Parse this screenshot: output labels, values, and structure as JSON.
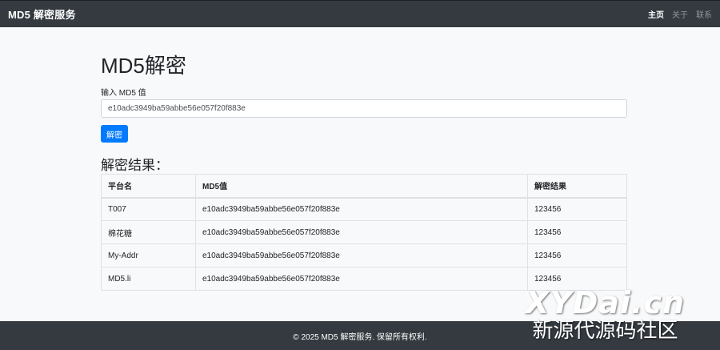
{
  "navbar": {
    "brand": "MD5 解密服务",
    "links": [
      {
        "label": "主页",
        "active": true
      },
      {
        "label": "关于",
        "active": false
      },
      {
        "label": "联系",
        "active": false
      }
    ]
  },
  "form": {
    "title": "MD5解密",
    "label": "输入 MD5 值",
    "input_value": "e10adc3949ba59abbe56e057f20f883e",
    "button_label": "解密"
  },
  "results": {
    "title": "解密结果：",
    "columns": [
      "平台名",
      "MD5值",
      "解密结果"
    ],
    "rows": [
      [
        "T007",
        "e10adc3949ba59abbe56e057f20f883e",
        "123456"
      ],
      [
        "棉花糖",
        "e10adc3949ba59abbe56e057f20f883e",
        "123456"
      ],
      [
        "My-Addr",
        "e10adc3949ba59abbe56e057f20f883e",
        "123456"
      ],
      [
        "MD5.li",
        "e10adc3949ba59abbe56e057f20f883e",
        "123456"
      ]
    ]
  },
  "footer": {
    "text": "© 2025 MD5 解密服务. 保留所有权利."
  },
  "watermark": {
    "line1": "XYDai.cn",
    "line2": "新源代源码社区"
  },
  "colors": {
    "navbar_bg": "#343a40",
    "primary": "#007bff",
    "page_bg": "#f8f9fa"
  }
}
